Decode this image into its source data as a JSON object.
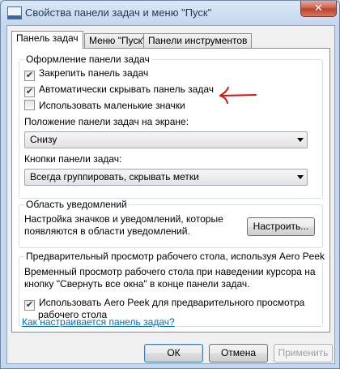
{
  "window": {
    "title": "Свойства панели задач и меню \"Пуск\"",
    "close_glyph": "✕"
  },
  "tabs": [
    {
      "label": "Панель задач",
      "active": true
    },
    {
      "label": "Меню \"Пуск\"",
      "active": false
    },
    {
      "label": "Панели инструментов",
      "active": false
    }
  ],
  "appearance": {
    "legend": "Оформление панели задач",
    "lock_taskbar": {
      "label": "Закрепить панель задач",
      "checked": true
    },
    "auto_hide": {
      "label": "Автоматически скрывать панель задач",
      "checked": true
    },
    "small_icons": {
      "label": "Использовать маленькие значки",
      "checked": false
    },
    "position_label": "Положение панели задач на экране:",
    "position_value": "Снизу",
    "buttons_label": "Кнопки панели задач:",
    "buttons_value": "Всегда группировать, скрывать метки"
  },
  "notification_area": {
    "legend": "Область уведомлений",
    "description_line1": "Настройка значков и уведомлений, которые",
    "description_line2": "появляются в области уведомлений.",
    "customize_button": "Настроить..."
  },
  "aero_peek": {
    "legend": "Предварительный просмотр рабочего стола, используя Aero Peek",
    "description_line1": "Временный просмотр рабочего стола при наведении курсора на",
    "description_line2": "кнопку \"Свернуть все окна\" в конце панели задач.",
    "checkbox_line1": "Использовать Aero Peek для предварительного просмотра",
    "checkbox_line2": "рабочего стола",
    "checked": true
  },
  "help_link": "Как настраивается панель задач?",
  "footer": {
    "ok": "ОК",
    "cancel": "Отмена",
    "apply": "Применить"
  },
  "annotation_color": "#e01010",
  "check_glyph": "✔"
}
